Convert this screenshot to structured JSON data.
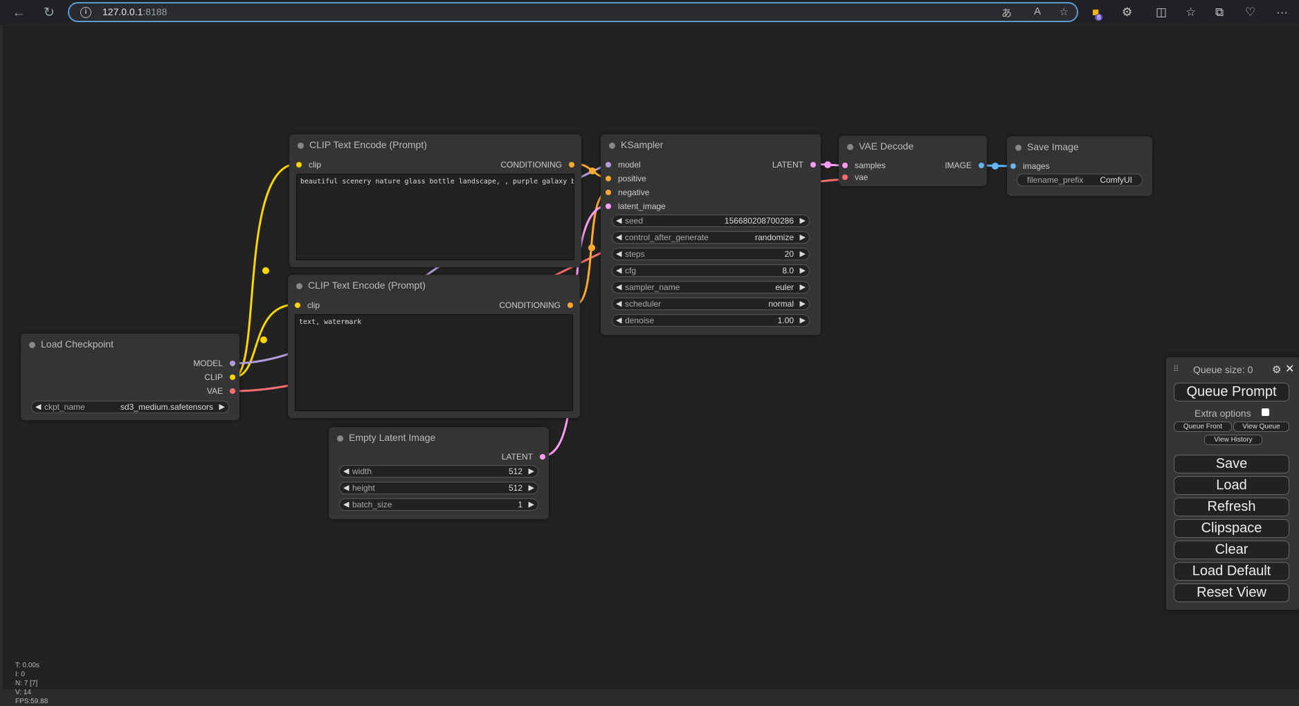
{
  "browser": {
    "url_host": "127.0.0.1",
    "url_port": ":8188",
    "extensions_badge": "8"
  },
  "colors": {
    "clip": "#ffd500",
    "conditioning": "#ffa931",
    "model": "#b39ddb",
    "vae": "#ff6e6e",
    "latent": "#ff9cf9",
    "image": "#64b5f6"
  },
  "nodes": {
    "clip_pos": {
      "title": "CLIP Text Encode (Prompt)",
      "input": "clip",
      "output": "CONDITIONING",
      "text": "beautiful scenery nature glass bottle landscape, , purple galaxy bottle,"
    },
    "clip_neg": {
      "title": "CLIP Text Encode (Prompt)",
      "input": "clip",
      "output": "CONDITIONING",
      "text": "text, watermark"
    },
    "ksampler": {
      "title": "KSampler",
      "inputs": [
        "model",
        "positive",
        "negative",
        "latent_image"
      ],
      "output": "LATENT",
      "widgets": [
        {
          "name": "seed",
          "value": "156680208700286"
        },
        {
          "name": "control_after_generate",
          "value": "randomize"
        },
        {
          "name": "steps",
          "value": "20"
        },
        {
          "name": "cfg",
          "value": "8.0"
        },
        {
          "name": "sampler_name",
          "value": "euler"
        },
        {
          "name": "scheduler",
          "value": "normal"
        },
        {
          "name": "denoise",
          "value": "1.00"
        }
      ]
    },
    "vae_decode": {
      "title": "VAE Decode",
      "inputs": [
        "samples",
        "vae"
      ],
      "output": "IMAGE"
    },
    "save_image": {
      "title": "Save Image",
      "input": "images",
      "widget": {
        "name": "filename_prefix",
        "value": "ComfyUI"
      }
    },
    "load_checkpoint": {
      "title": "Load Checkpoint",
      "outputs": [
        "MODEL",
        "CLIP",
        "VAE"
      ],
      "widget": {
        "name": "ckpt_name",
        "value": "sd3_medium.safetensors"
      }
    },
    "empty_latent": {
      "title": "Empty Latent Image",
      "output": "LATENT",
      "widgets": [
        {
          "name": "width",
          "value": "512"
        },
        {
          "name": "height",
          "value": "512"
        },
        {
          "name": "batch_size",
          "value": "1"
        }
      ]
    }
  },
  "menu": {
    "queue_size": "Queue size: 0",
    "queue_prompt": "Queue Prompt",
    "extra_options": "Extra options",
    "queue_front": "Queue Front",
    "view_queue": "View Queue",
    "view_history": "View History",
    "save": "Save",
    "load": "Load",
    "refresh": "Refresh",
    "clipspace": "Clipspace",
    "clear": "Clear",
    "load_default": "Load Default",
    "reset_view": "Reset View"
  },
  "stats": {
    "t": "T: 0.00s",
    "i": "I: 0",
    "n": "N: 7 [7]",
    "v": "V: 14",
    "fps": "FPS:59.88"
  }
}
